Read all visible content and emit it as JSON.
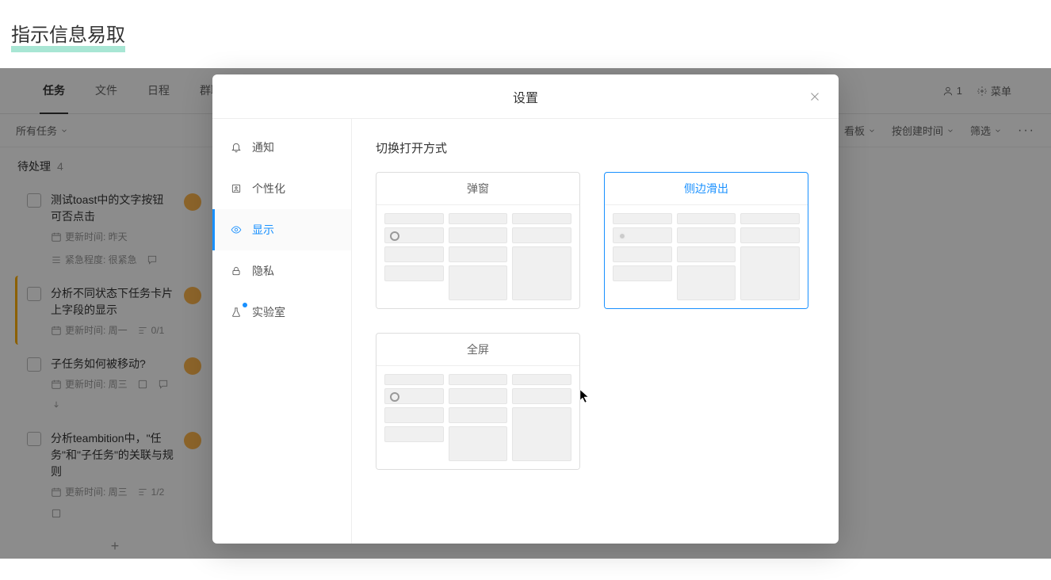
{
  "page_heading": "指示信息易取",
  "topbar": {
    "tabs": [
      "任务",
      "文件",
      "日程",
      "群聊"
    ],
    "members_count": "1",
    "menu_label": "菜单"
  },
  "filterbar": {
    "left": "所有任务",
    "right": {
      "view": "看板",
      "sort": "按创建时间",
      "filter": "筛选"
    }
  },
  "section": {
    "title": "待处理",
    "count": "4"
  },
  "tasks": [
    {
      "title": "测试toast中的文字按钮可否点击",
      "meta": [
        {
          "icon": "calendar",
          "text": "更新时间: 昨天"
        },
        {
          "icon": "priority",
          "text": "紧急程度: 很紧急"
        },
        {
          "icon": "chat",
          "text": ""
        }
      ],
      "highlighted": false
    },
    {
      "title": "分析不同状态下任务卡片上字段的显示",
      "meta": [
        {
          "icon": "calendar",
          "text": "更新时间: 周一"
        },
        {
          "icon": "subtask",
          "text": "0/1"
        }
      ],
      "highlighted": true
    },
    {
      "title": "子任务如何被移动?",
      "meta": [
        {
          "icon": "calendar",
          "text": "更新时间: 周三"
        },
        {
          "icon": "link",
          "text": ""
        },
        {
          "icon": "chat",
          "text": ""
        },
        {
          "icon": "attach",
          "text": ""
        }
      ],
      "highlighted": false
    },
    {
      "title": "分析teambition中，\"任务\"和\"子任务\"的关联与规则",
      "meta": [
        {
          "icon": "calendar",
          "text": "更新时间: 周三"
        },
        {
          "icon": "subtask",
          "text": "1/2"
        },
        {
          "icon": "link",
          "text": ""
        }
      ],
      "highlighted": false
    }
  ],
  "modal": {
    "title": "设置",
    "sidebar": [
      {
        "icon": "bell",
        "label": "通知",
        "active": false
      },
      {
        "icon": "personal",
        "label": "个性化",
        "active": false
      },
      {
        "icon": "eye",
        "label": "显示",
        "active": true
      },
      {
        "icon": "lock",
        "label": "隐私",
        "active": false
      },
      {
        "icon": "flask",
        "label": "实验室",
        "active": false,
        "dot": true
      }
    ],
    "content_title": "切换打开方式",
    "modes": [
      {
        "label": "弹窗",
        "selected": false
      },
      {
        "label": "侧边滑出",
        "selected": true
      },
      {
        "label": "全屏",
        "selected": false
      }
    ]
  }
}
